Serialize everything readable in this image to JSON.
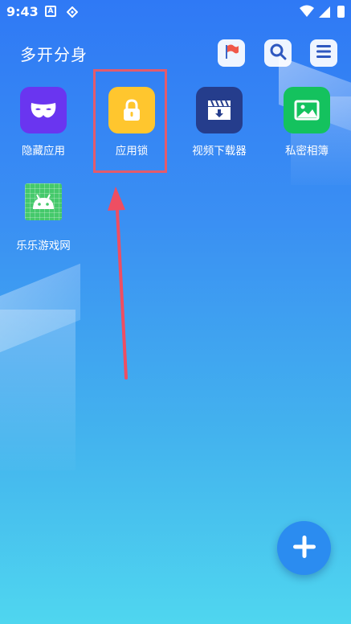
{
  "status_bar": {
    "time": "9:43",
    "icons": [
      "a-notification-icon",
      "diamond-icon",
      "wifi-icon",
      "signal-icon",
      "battery-icon"
    ]
  },
  "header": {
    "title": "多开分身",
    "buttons": [
      "flag-icon",
      "search-icon",
      "menu-icon"
    ]
  },
  "apps": [
    {
      "label": "隐藏应用",
      "icon": "mask-icon",
      "color": "#6a35f0"
    },
    {
      "label": "应用锁",
      "icon": "lock-icon",
      "color": "#ffc62e"
    },
    {
      "label": "视频下载器",
      "icon": "video-download-icon",
      "color": "#253d8c"
    },
    {
      "label": "私密相簿",
      "icon": "photo-icon",
      "color": "#14c25e"
    },
    {
      "label": "乐乐游戏网",
      "icon": "android-icon",
      "color": "#45c96b"
    }
  ],
  "annotation": {
    "highlight_color": "#e35b6c",
    "arrow_color": "#ee4e62"
  },
  "fab": {
    "icon": "plus-icon"
  }
}
